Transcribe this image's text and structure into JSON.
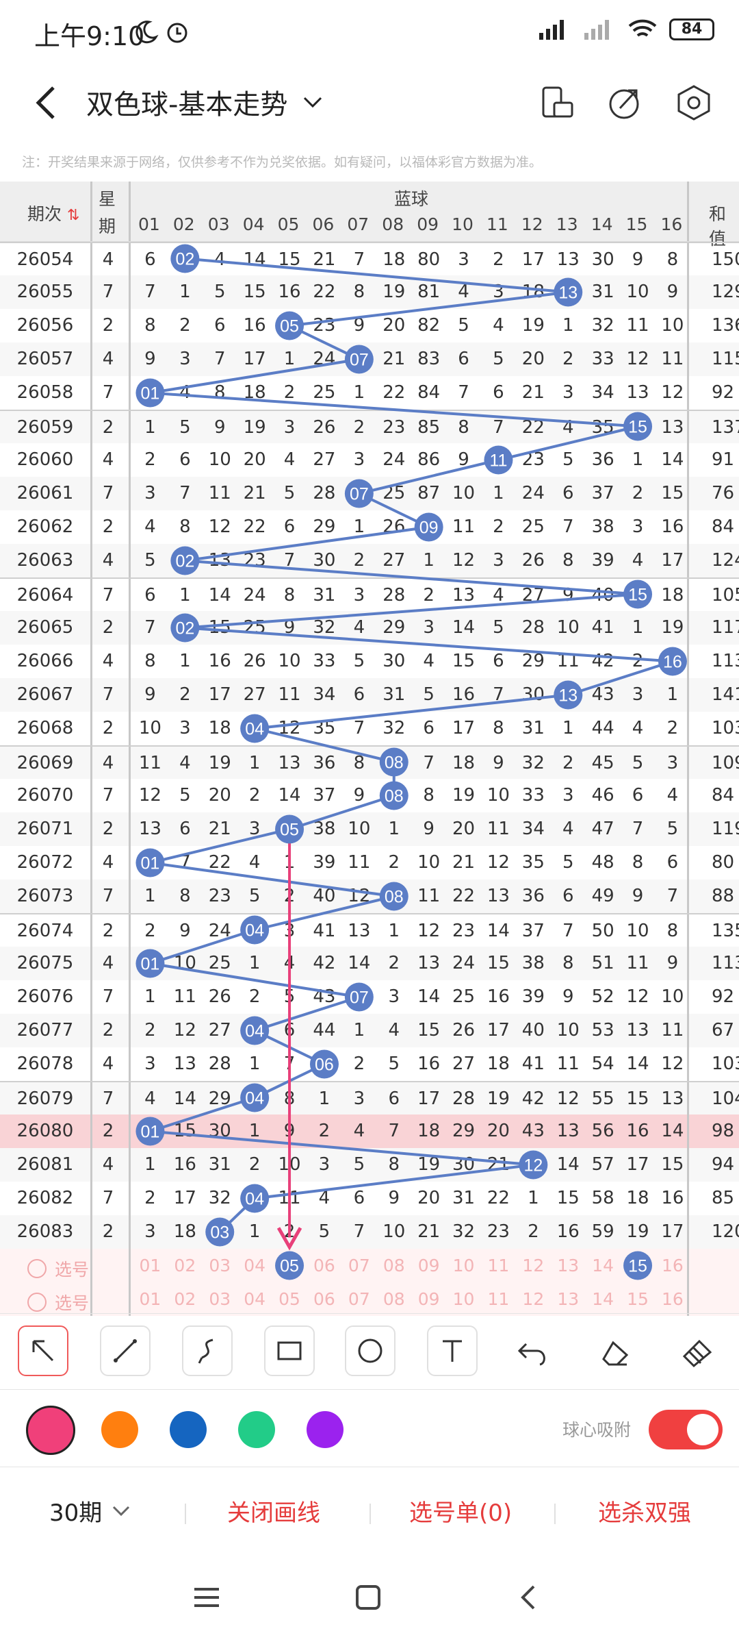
{
  "status": {
    "time": "上午9:10",
    "battery": "84"
  },
  "header": {
    "title": "双色球-基本走势"
  },
  "note": "注：开奖结果来源于网络，仅供参考不作为兑奖依据。如有疑问，以福体彩官方数据为准。",
  "table": {
    "col_issue": "期次",
    "col_week_1": "星",
    "col_week_2": "期",
    "group_blue": "蓝球",
    "col_sum": "和值",
    "blue_headers": [
      "01",
      "02",
      "03",
      "04",
      "05",
      "06",
      "07",
      "08",
      "09",
      "10",
      "11",
      "12",
      "13",
      "14",
      "15",
      "16"
    ],
    "rows": [
      {
        "issue": "26054",
        "week": "4",
        "cells": [
          "6",
          "02",
          "4",
          "14",
          "15",
          "21",
          "7",
          "18",
          "80",
          "3",
          "2",
          "17",
          "13",
          "30",
          "9",
          "8"
        ],
        "sum": "150"
      },
      {
        "issue": "26055",
        "week": "7",
        "cells": [
          "7",
          "1",
          "5",
          "15",
          "16",
          "22",
          "8",
          "19",
          "81",
          "4",
          "3",
          "18",
          "13",
          "31",
          "10",
          "9"
        ],
        "sum": "129"
      },
      {
        "issue": "26056",
        "week": "2",
        "cells": [
          "8",
          "2",
          "6",
          "16",
          "05",
          "23",
          "9",
          "20",
          "82",
          "5",
          "4",
          "19",
          "1",
          "32",
          "11",
          "10"
        ],
        "sum": "136"
      },
      {
        "issue": "26057",
        "week": "4",
        "cells": [
          "9",
          "3",
          "7",
          "17",
          "1",
          "24",
          "07",
          "21",
          "83",
          "6",
          "5",
          "20",
          "2",
          "33",
          "12",
          "11"
        ],
        "sum": "115"
      },
      {
        "issue": "26058",
        "week": "7",
        "cells": [
          "01",
          "4",
          "8",
          "18",
          "2",
          "25",
          "1",
          "22",
          "84",
          "7",
          "6",
          "21",
          "3",
          "34",
          "13",
          "12"
        ],
        "sum": "92"
      },
      {
        "issue": "26059",
        "week": "2",
        "cells": [
          "1",
          "5",
          "9",
          "19",
          "3",
          "26",
          "2",
          "23",
          "85",
          "8",
          "7",
          "22",
          "4",
          "35",
          "15",
          "13"
        ],
        "sum": "137"
      },
      {
        "issue": "26060",
        "week": "4",
        "cells": [
          "2",
          "6",
          "10",
          "20",
          "4",
          "27",
          "3",
          "24",
          "86",
          "9",
          "11",
          "23",
          "5",
          "36",
          "1",
          "14"
        ],
        "sum": "91"
      },
      {
        "issue": "26061",
        "week": "7",
        "cells": [
          "3",
          "7",
          "11",
          "21",
          "5",
          "28",
          "07",
          "25",
          "87",
          "10",
          "1",
          "24",
          "6",
          "37",
          "2",
          "15"
        ],
        "sum": "76"
      },
      {
        "issue": "26062",
        "week": "2",
        "cells": [
          "4",
          "8",
          "12",
          "22",
          "6",
          "29",
          "1",
          "26",
          "09",
          "11",
          "2",
          "25",
          "7",
          "38",
          "3",
          "16"
        ],
        "sum": "84"
      },
      {
        "issue": "26063",
        "week": "4",
        "cells": [
          "5",
          "02",
          "13",
          "23",
          "7",
          "30",
          "2",
          "27",
          "1",
          "12",
          "3",
          "26",
          "8",
          "39",
          "4",
          "17"
        ],
        "sum": "124"
      },
      {
        "issue": "26064",
        "week": "7",
        "cells": [
          "6",
          "1",
          "14",
          "24",
          "8",
          "31",
          "3",
          "28",
          "2",
          "13",
          "4",
          "27",
          "9",
          "40",
          "15",
          "18"
        ],
        "sum": "105"
      },
      {
        "issue": "26065",
        "week": "2",
        "cells": [
          "7",
          "02",
          "15",
          "25",
          "9",
          "32",
          "4",
          "29",
          "3",
          "14",
          "5",
          "28",
          "10",
          "41",
          "1",
          "19"
        ],
        "sum": "117"
      },
      {
        "issue": "26066",
        "week": "4",
        "cells": [
          "8",
          "1",
          "16",
          "26",
          "10",
          "33",
          "5",
          "30",
          "4",
          "15",
          "6",
          "29",
          "11",
          "42",
          "2",
          "16"
        ],
        "sum": "113"
      },
      {
        "issue": "26067",
        "week": "7",
        "cells": [
          "9",
          "2",
          "17",
          "27",
          "11",
          "34",
          "6",
          "31",
          "5",
          "16",
          "7",
          "30",
          "13",
          "43",
          "3",
          "1"
        ],
        "sum": "141"
      },
      {
        "issue": "26068",
        "week": "2",
        "cells": [
          "10",
          "3",
          "18",
          "04",
          "12",
          "35",
          "7",
          "32",
          "6",
          "17",
          "8",
          "31",
          "1",
          "44",
          "4",
          "2"
        ],
        "sum": "103"
      },
      {
        "issue": "26069",
        "week": "4",
        "cells": [
          "11",
          "4",
          "19",
          "1",
          "13",
          "36",
          "8",
          "08",
          "7",
          "18",
          "9",
          "32",
          "2",
          "45",
          "5",
          "3"
        ],
        "sum": "109"
      },
      {
        "issue": "26070",
        "week": "7",
        "cells": [
          "12",
          "5",
          "20",
          "2",
          "14",
          "37",
          "9",
          "08",
          "8",
          "19",
          "10",
          "33",
          "3",
          "46",
          "6",
          "4"
        ],
        "sum": "84"
      },
      {
        "issue": "26071",
        "week": "2",
        "cells": [
          "13",
          "6",
          "21",
          "3",
          "05",
          "38",
          "10",
          "1",
          "9",
          "20",
          "11",
          "34",
          "4",
          "47",
          "7",
          "5"
        ],
        "sum": "119"
      },
      {
        "issue": "26072",
        "week": "4",
        "cells": [
          "01",
          "7",
          "22",
          "4",
          "1",
          "39",
          "11",
          "2",
          "10",
          "21",
          "12",
          "35",
          "5",
          "48",
          "8",
          "6"
        ],
        "sum": "80"
      },
      {
        "issue": "26073",
        "week": "7",
        "cells": [
          "1",
          "8",
          "23",
          "5",
          "2",
          "40",
          "12",
          "08",
          "11",
          "22",
          "13",
          "36",
          "6",
          "49",
          "9",
          "7"
        ],
        "sum": "88"
      },
      {
        "issue": "26074",
        "week": "2",
        "cells": [
          "2",
          "9",
          "24",
          "04",
          "3",
          "41",
          "13",
          "1",
          "12",
          "23",
          "14",
          "37",
          "7",
          "50",
          "10",
          "8"
        ],
        "sum": "135"
      },
      {
        "issue": "26075",
        "week": "4",
        "cells": [
          "01",
          "10",
          "25",
          "1",
          "4",
          "42",
          "14",
          "2",
          "13",
          "24",
          "15",
          "38",
          "8",
          "51",
          "11",
          "9"
        ],
        "sum": "113"
      },
      {
        "issue": "26076",
        "week": "7",
        "cells": [
          "1",
          "11",
          "26",
          "2",
          "5",
          "43",
          "07",
          "3",
          "14",
          "25",
          "16",
          "39",
          "9",
          "52",
          "12",
          "10"
        ],
        "sum": "92"
      },
      {
        "issue": "26077",
        "week": "2",
        "cells": [
          "2",
          "12",
          "27",
          "04",
          "6",
          "44",
          "1",
          "4",
          "15",
          "26",
          "17",
          "40",
          "10",
          "53",
          "13",
          "11"
        ],
        "sum": "67"
      },
      {
        "issue": "26078",
        "week": "4",
        "cells": [
          "3",
          "13",
          "28",
          "1",
          "7",
          "06",
          "2",
          "5",
          "16",
          "27",
          "18",
          "41",
          "11",
          "54",
          "14",
          "12"
        ],
        "sum": "103"
      },
      {
        "issue": "26079",
        "week": "7",
        "cells": [
          "4",
          "14",
          "29",
          "04",
          "8",
          "1",
          "3",
          "6",
          "17",
          "28",
          "19",
          "42",
          "12",
          "55",
          "15",
          "13"
        ],
        "sum": "104"
      },
      {
        "issue": "26080",
        "week": "2",
        "cells": [
          "01",
          "15",
          "30",
          "1",
          "9",
          "2",
          "4",
          "7",
          "18",
          "29",
          "20",
          "43",
          "13",
          "56",
          "16",
          "14"
        ],
        "sum": "98"
      },
      {
        "issue": "26081",
        "week": "4",
        "cells": [
          "1",
          "16",
          "31",
          "2",
          "10",
          "3",
          "5",
          "8",
          "19",
          "30",
          "21",
          "12",
          "14",
          "57",
          "17",
          "15"
        ],
        "sum": "94"
      },
      {
        "issue": "26082",
        "week": "7",
        "cells": [
          "2",
          "17",
          "32",
          "04",
          "11",
          "4",
          "6",
          "9",
          "20",
          "31",
          "22",
          "1",
          "15",
          "58",
          "18",
          "16"
        ],
        "sum": "85"
      },
      {
        "issue": "26083",
        "week": "2",
        "cells": [
          "3",
          "18",
          "03",
          "1",
          "2",
          "5",
          "7",
          "10",
          "21",
          "32",
          "23",
          "2",
          "16",
          "59",
          "19",
          "17"
        ],
        "sum": "120"
      }
    ],
    "balls": [
      2,
      13,
      5,
      7,
      1,
      15,
      11,
      7,
      9,
      2,
      15,
      2,
      16,
      13,
      4,
      8,
      8,
      5,
      1,
      8,
      4,
      1,
      7,
      4,
      6,
      4,
      1,
      12,
      4,
      3
    ],
    "pick_label": "选号",
    "pick1_selected": [
      5,
      15
    ]
  },
  "colors": {
    "ball": "#5b7dc6",
    "line": "#5b7dc6",
    "arrow": "#e8407a",
    "accent": "#e53c3c",
    "palette": [
      "#f0407a",
      "#ff7f0f",
      "#1565c0",
      "#22cc88",
      "#9b22ee"
    ]
  },
  "bottom": {
    "period": "30期",
    "close_lines": "关闭画线",
    "pick_list": "选号单(0)",
    "kill": "选杀双强"
  },
  "snap_label": "球心吸附"
}
